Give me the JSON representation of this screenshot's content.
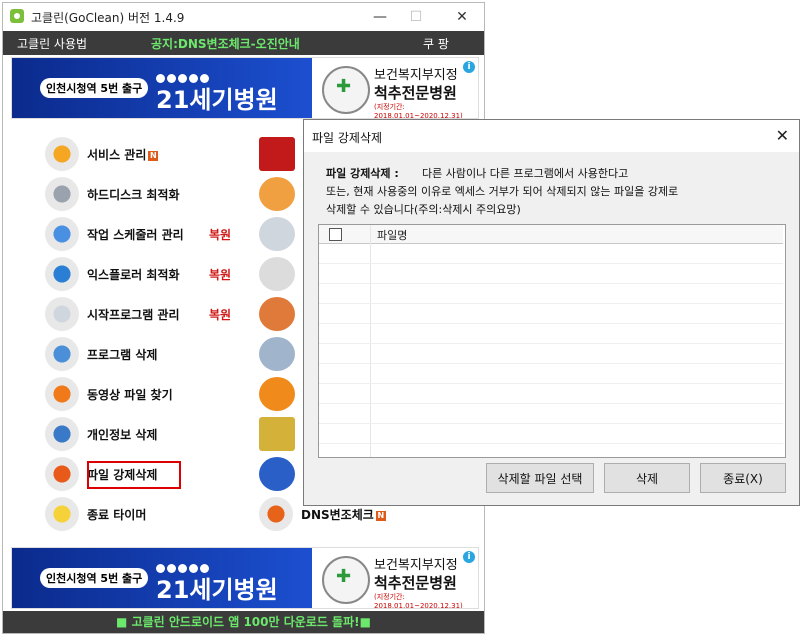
{
  "window": {
    "title": "고클린(GoClean) 버전 1.4.9"
  },
  "menubar": {
    "manual": "고클린 사용법",
    "notice": "공지:DNS변조체크-오진안내",
    "coupang": "쿠 팡"
  },
  "banner": {
    "exit_text": "인천시청역 5번 출구",
    "hospital_name": "21세기병원",
    "right_line1": "보건복지부지정",
    "right_line2": "척추전문병원",
    "right_line3": "(지정기간: 2018.01.01~2020.12.31)",
    "info": "i"
  },
  "menu_left": [
    {
      "label": "서비스 관리",
      "tag": "",
      "badge": "N"
    },
    {
      "label": "하드디스크 최적화",
      "tag": "",
      "badge": ""
    },
    {
      "label": "작업 스케줄러 관리",
      "tag": "복원",
      "badge": ""
    },
    {
      "label": "익스플로러 최적화",
      "tag": "복원",
      "badge": ""
    },
    {
      "label": "시작프로그램 관리",
      "tag": "복원",
      "badge": ""
    },
    {
      "label": "프로그램 삭제",
      "tag": "",
      "badge": ""
    },
    {
      "label": "동영상 파일 찾기",
      "tag": "",
      "badge": ""
    },
    {
      "label": "개인정보 삭제",
      "tag": "",
      "badge": ""
    },
    {
      "label": "파일 강제삭제",
      "tag": "",
      "badge": ""
    },
    {
      "label": "종료 타이머",
      "tag": "",
      "badge": ""
    }
  ],
  "menu_right_last": {
    "label": "DNS변조체크",
    "badge": "N"
  },
  "footer": {
    "notice": "■ 고클린 안드로이드 앱 100만 다운로드 돌파!■"
  },
  "dialog": {
    "title": "파일 강제삭제",
    "desc_head": "파일 강제삭제 :",
    "desc_line1": "다른 사람이나 다른 프로그램에서 사용한다고",
    "desc_line2": "또는, 현재 사용중의 이유로 엑세스 거부가 되어 삭제되지 않는 파일을 강제로",
    "desc_line3": "삭제할 수 있습니다(주의:삭제시 주의요망)",
    "col_filename": "파일명",
    "btn_select": "삭제할 파일 선택",
    "btn_delete": "삭제",
    "btn_close": "종료(X)"
  }
}
